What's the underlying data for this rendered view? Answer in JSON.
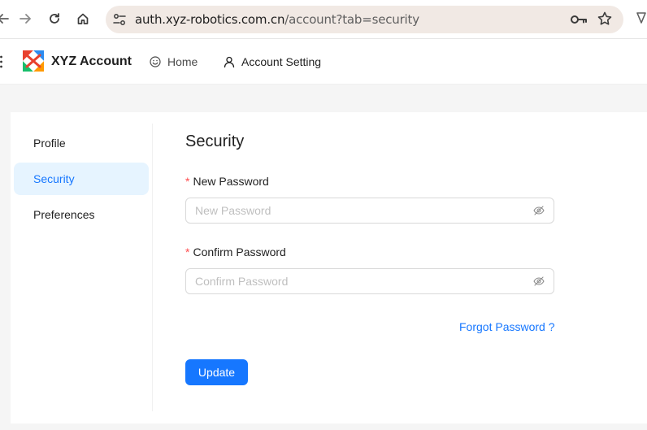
{
  "browser": {
    "url_host": "auth.xyz-robotics.com.cn",
    "url_path": "/account?tab=security",
    "icons": [
      "back-arrow-icon",
      "forward-arrow-icon",
      "reload-icon",
      "home-icon",
      "site-settings-icon",
      "key-icon",
      "star-icon"
    ]
  },
  "header": {
    "brand": "XYZ Account",
    "nav": [
      {
        "label": "Home",
        "icon": "smile-icon"
      },
      {
        "label": "Account Setting",
        "icon": "user-icon"
      }
    ]
  },
  "sidebar": {
    "items": [
      {
        "label": "Profile",
        "active": false
      },
      {
        "label": "Security",
        "active": true
      },
      {
        "label": "Preferences",
        "active": false
      }
    ]
  },
  "form": {
    "title": "Security",
    "new_password": {
      "label": "New Password",
      "required_mark": "*",
      "placeholder": "New Password",
      "value": ""
    },
    "confirm_password": {
      "label": "Confirm Password",
      "required_mark": "*",
      "placeholder": "Confirm Password",
      "value": ""
    },
    "forgot_label": "Forgot Password ?",
    "update_label": "Update"
  },
  "colors": {
    "accent": "#1677ff",
    "active_bg": "#e6f4ff",
    "required": "#ff4d4f",
    "url_bar_bg": "#f1e9e4"
  }
}
